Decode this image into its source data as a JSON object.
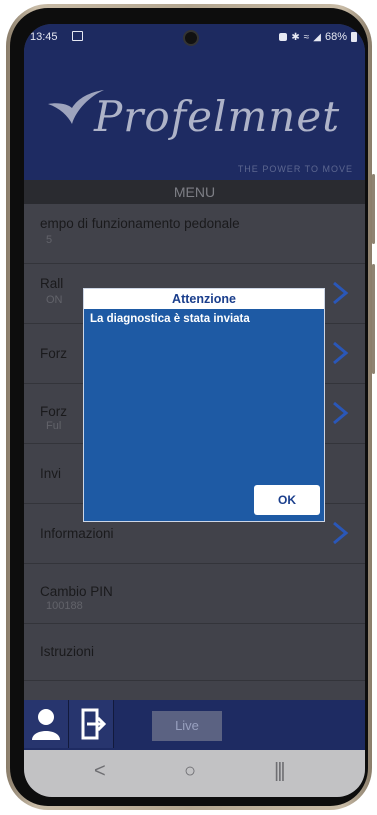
{
  "status_bar": {
    "time": "13:45",
    "battery": "68%",
    "icons": [
      "image-notification-icon",
      "mute-icon",
      "bluetooth-icon",
      "wifi-icon",
      "signal-icon",
      "battery-icon"
    ]
  },
  "header": {
    "logo": "Profelmnet",
    "tagline": "THE POWER TO MOVE"
  },
  "menu_title": "MENU",
  "items": [
    {
      "label": "empo di funzionamento pedonale",
      "value": "5"
    },
    {
      "label": "Rall",
      "value": "ON"
    },
    {
      "label": "Forz",
      "value": ""
    },
    {
      "label": "Forz",
      "value": "Ful"
    },
    {
      "label": "Invi",
      "value": ""
    },
    {
      "label": "Informazioni",
      "value": ""
    },
    {
      "label": "Cambio PIN",
      "value": "100188"
    },
    {
      "label": "Istruzioni",
      "value": ""
    }
  ],
  "bottom_bar": {
    "live_label": "Live",
    "icons": [
      "user-icon",
      "logout-icon"
    ]
  },
  "android_nav": {
    "back": "<",
    "home": "○",
    "recents": "|||"
  },
  "dialog": {
    "title": "Attenzione",
    "message": "La diagnostica è stata inviata",
    "ok_label": "OK"
  },
  "colors": {
    "header_blue": "#1e2b62",
    "dialog_blue": "#1e5aa4",
    "list_bg": "#41424a",
    "accent_chevron": "#2a57b8"
  }
}
